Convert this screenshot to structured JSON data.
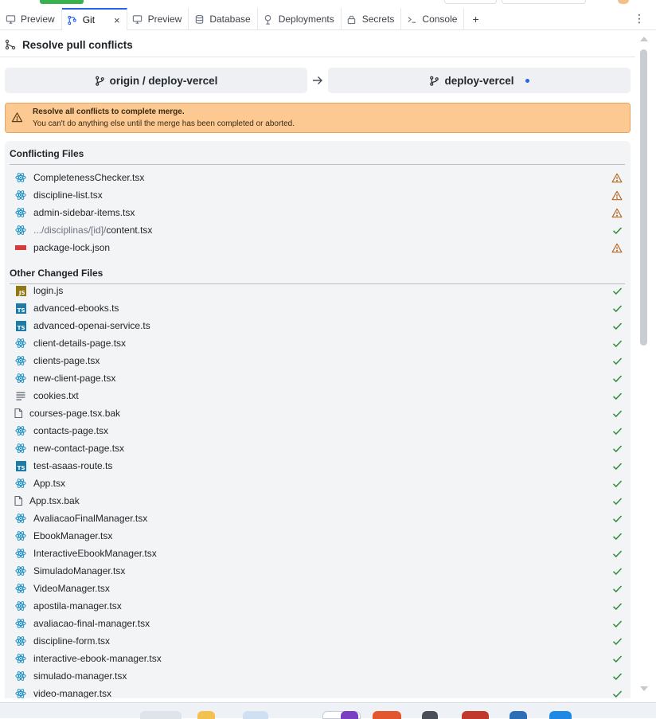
{
  "tabs": [
    {
      "label": "Preview",
      "icon": "monitor-icon",
      "active": false
    },
    {
      "label": "Git",
      "icon": "git-icon",
      "active": true,
      "closable": true
    },
    {
      "label": "Preview",
      "icon": "monitor-icon",
      "active": false
    },
    {
      "label": "Database",
      "icon": "database-icon",
      "active": false
    },
    {
      "label": "Deployments",
      "icon": "deployments-icon",
      "active": false
    },
    {
      "label": "Secrets",
      "icon": "lock-icon",
      "active": false
    },
    {
      "label": "Console",
      "icon": "terminal-icon",
      "active": false
    }
  ],
  "tab_add": "+",
  "tab_menu": "⋮",
  "tab_close": "×",
  "pane": {
    "title": "Resolve pull conflicts",
    "icon": "merge-icon"
  },
  "branches": {
    "source": "origin / deploy-vercel",
    "target": "deploy-vercel",
    "target_modified": true
  },
  "warning": {
    "title": "Resolve all conflicts to complete merge.",
    "message": "You can't do anything else until the merge has been completed or aborted."
  },
  "conflicting": {
    "heading": "Conflicting Files",
    "files": [
      {
        "name": "CompletenessChecker.tsx",
        "type": "react",
        "status": "conflict"
      },
      {
        "name": "discipline-list.tsx",
        "type": "react",
        "status": "conflict"
      },
      {
        "name": "admin-sidebar-items.tsx",
        "type": "react",
        "status": "conflict"
      },
      {
        "prefix": ".../disciplinas/[id]/",
        "name": "content.tsx",
        "type": "react",
        "status": "resolved"
      },
      {
        "name": "package-lock.json",
        "type": "npm",
        "status": "conflict"
      }
    ]
  },
  "changed": {
    "heading": "Other Changed Files",
    "files": [
      {
        "name": "login.js",
        "type": "js",
        "status": "resolved"
      },
      {
        "name": "advanced-ebooks.ts",
        "type": "ts",
        "status": "resolved"
      },
      {
        "name": "advanced-openai-service.ts",
        "type": "ts",
        "status": "resolved"
      },
      {
        "name": "client-details-page.tsx",
        "type": "react",
        "status": "resolved"
      },
      {
        "name": "clients-page.tsx",
        "type": "react",
        "status": "resolved"
      },
      {
        "name": "new-client-page.tsx",
        "type": "react",
        "status": "resolved"
      },
      {
        "name": "cookies.txt",
        "type": "text",
        "status": "resolved"
      },
      {
        "name": "courses-page.tsx.bak",
        "type": "file",
        "status": "resolved"
      },
      {
        "name": "contacts-page.tsx",
        "type": "react",
        "status": "resolved"
      },
      {
        "name": "new-contact-page.tsx",
        "type": "react",
        "status": "resolved"
      },
      {
        "name": "test-asaas-route.ts",
        "type": "ts",
        "status": "resolved"
      },
      {
        "name": "App.tsx",
        "type": "react",
        "status": "resolved"
      },
      {
        "name": "App.tsx.bak",
        "type": "file",
        "status": "resolved"
      },
      {
        "name": "AvaliacaoFinalManager.tsx",
        "type": "react",
        "status": "resolved"
      },
      {
        "name": "EbookManager.tsx",
        "type": "react",
        "status": "resolved"
      },
      {
        "name": "InteractiveEbookManager.tsx",
        "type": "react",
        "status": "resolved"
      },
      {
        "name": "SimuladoManager.tsx",
        "type": "react",
        "status": "resolved"
      },
      {
        "name": "VideoManager.tsx",
        "type": "react",
        "status": "resolved"
      },
      {
        "name": "apostila-manager.tsx",
        "type": "react",
        "status": "resolved"
      },
      {
        "name": "avaliacao-final-manager.tsx",
        "type": "react",
        "status": "resolved"
      },
      {
        "name": "discipline-form.tsx",
        "type": "react",
        "status": "resolved"
      },
      {
        "name": "interactive-ebook-manager.tsx",
        "type": "react",
        "status": "resolved"
      },
      {
        "name": "simulado-manager.tsx",
        "type": "react",
        "status": "resolved"
      },
      {
        "name": "video-manager.tsx",
        "type": "react",
        "status": "resolved"
      }
    ]
  },
  "badges": {
    "js": "JS",
    "ts": "TS"
  },
  "colors": {
    "accent": "#2563eb",
    "warning_bg": "#fdc993",
    "warning_border": "#e7a461",
    "resolved": "#2f8f3a",
    "conflict": "#b5651d",
    "react": "#1a8fc4",
    "npm": "#d63a3a"
  }
}
